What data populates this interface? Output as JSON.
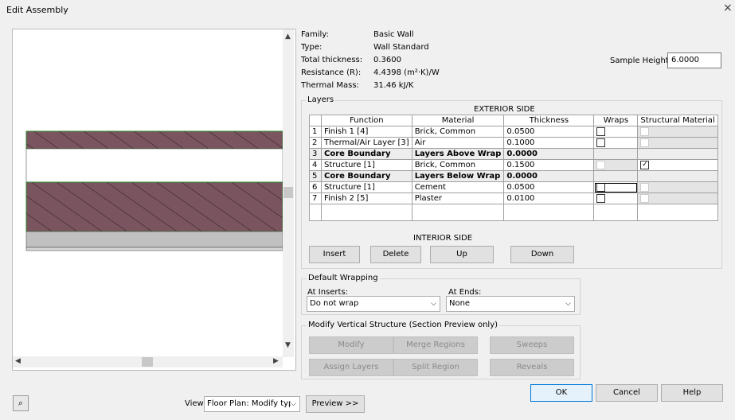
{
  "window": {
    "title": "Edit Assembly",
    "close": "×"
  },
  "info": {
    "family_label": "Family:",
    "family_value": "Basic Wall",
    "type_label": "Type:",
    "type_value": "Wall Standard",
    "thickness_label": "Total thickness:",
    "thickness_value": "0.3600",
    "resistance_label": "Resistance (R):",
    "resistance_value": "4.4398 (m²·K)/W",
    "mass_label": "Thermal Mass:",
    "mass_value": "31.46 kJ/K",
    "sample_height_label": "Sample Height:",
    "sample_height_value": "6.0000"
  },
  "layers": {
    "group_title": "Layers",
    "exterior_side": "EXTERIOR SIDE",
    "interior_side": "INTERIOR SIDE",
    "columns": [
      "Function",
      "Material",
      "Thickness",
      "Wraps",
      "Structural Material"
    ],
    "rows": [
      {
        "num": "1",
        "function": "Finish 1 [4]",
        "material": "Brick, Common",
        "thickness": "0.0500"
      },
      {
        "num": "2",
        "function": "Thermal/Air Layer [3]",
        "material": "Air",
        "thickness": "0.1000"
      },
      {
        "num": "3",
        "function": "Core Boundary",
        "material": "Layers Above Wrap",
        "thickness": "0.0000"
      },
      {
        "num": "4",
        "function": "Structure [1]",
        "material": "Brick, Common",
        "thickness": "0.1500"
      },
      {
        "num": "5",
        "function": "Core Boundary",
        "material": "Layers Below Wrap",
        "thickness": "0.0000"
      },
      {
        "num": "6",
        "function": "Structure [1]",
        "material": "Cement",
        "thickness": "0.0500"
      },
      {
        "num": "7",
        "function": "Finish 2 [5]",
        "material": "Plaster",
        "thickness": "0.0100"
      }
    ],
    "buttons": {
      "insert": "Insert",
      "delete": "Delete",
      "up": "Up",
      "down": "Down"
    }
  },
  "wrapping": {
    "group_title": "Default Wrapping",
    "inserts_label": "At Inserts:",
    "inserts_value": "Do not wrap",
    "ends_label": "At Ends:",
    "ends_value": "None"
  },
  "vertical": {
    "group_title": "Modify Vertical Structure (Section Preview only)",
    "modify": "Modify",
    "merge": "Merge Regions",
    "sweeps": "Sweeps",
    "assign": "Assign Layers",
    "split": "Split Region",
    "reveals": "Reveals"
  },
  "footer": {
    "view_label": "View:",
    "view_value": "Floor Plan: Modify typ",
    "preview_button": "Preview >>",
    "ok": "OK",
    "cancel": "Cancel",
    "help": "Help"
  },
  "colors": {
    "brick": "#7a5560",
    "concrete": "#c0c0c0"
  }
}
